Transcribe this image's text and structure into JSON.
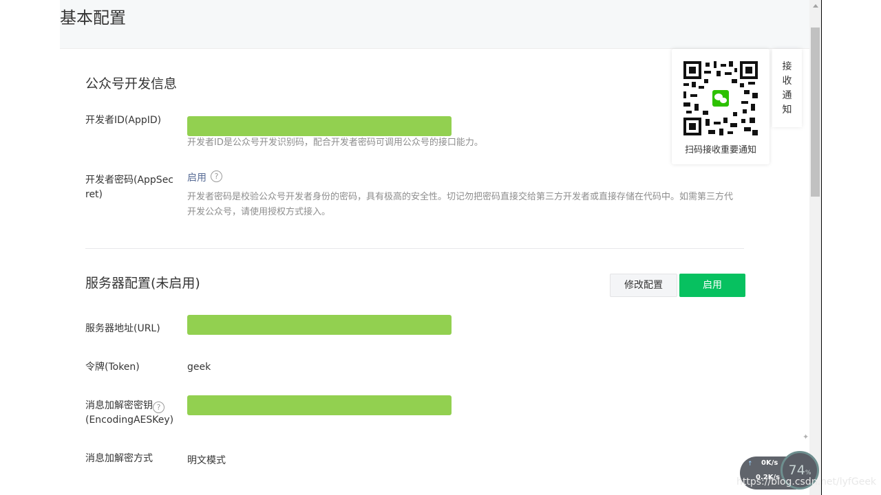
{
  "page": {
    "title": "基本配置"
  },
  "dev_info": {
    "section_title": "公众号开发信息",
    "appid_label": "开发者ID(AppID)",
    "appid_hint": "开发者ID是公众号开发识别码，配合开发者密码可调用公众号的接口能力。",
    "secret_label_line1": "开发者密码(AppSec",
    "secret_label_line2": "ret)",
    "secret_link": "启用",
    "secret_help_icon": "?",
    "secret_hint_line1": "开发者密码是校验公众号开发者身份的密码，具有极高的安全性。切记勿把密码直接交给第三方开发者或直接存储在代码中。如需第三方代",
    "secret_hint_line2": "开发公众号，请使用授权方式接入。"
  },
  "server_config": {
    "section_title": "服务器配置(未启用)",
    "edit_button": "修改配置",
    "enable_button": "启用",
    "url_label": "服务器地址(URL)",
    "token_label": "令牌(Token)",
    "token_value": "geek",
    "aes_label_line1": "消息加解密密钥",
    "aes_help_icon": "?",
    "aes_label_line2": "(EncodingAESKey)",
    "mode_label": "消息加解密方式",
    "mode_value": "明文模式"
  },
  "qr_panel": {
    "caption": "扫码接收重要通知",
    "icon": "wechat-qr-code"
  },
  "notify_tab": {
    "chars": [
      "接",
      "收",
      "通",
      "知"
    ]
  },
  "speed_widget": {
    "up_arrow": "↑",
    "upload": "0K/s",
    "download": "0.2K/s",
    "percent": "74",
    "percent_unit": "%"
  },
  "watermark": "https://blog.csdn.net/lyfGeek",
  "colors": {
    "primary_green": "#07c160",
    "redaction_green": "#92d050",
    "link_blue": "#576b95",
    "hint_gray": "#8d8d8d"
  }
}
